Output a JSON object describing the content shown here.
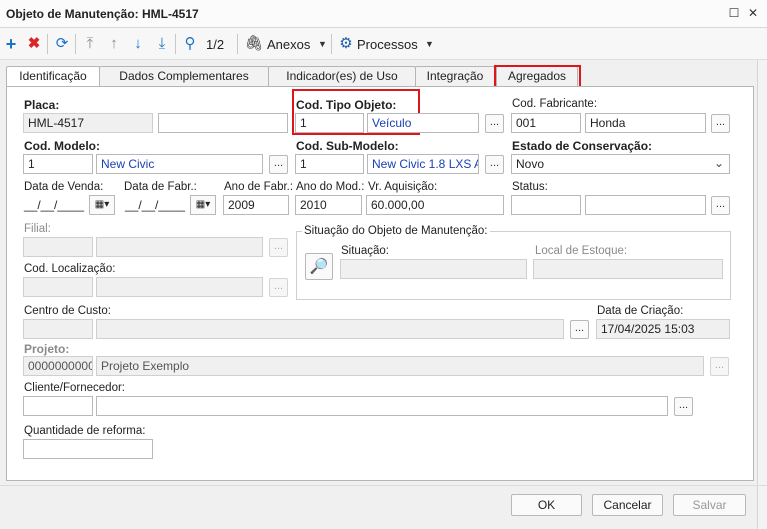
{
  "window": {
    "title": "Objeto de Manutenção: HML-4517"
  },
  "toolbar": {
    "page_indicator": "1/2",
    "attachments_label": "Anexos",
    "processes_label": "Processos"
  },
  "tabs": [
    {
      "label": "Identificação",
      "active": true
    },
    {
      "label": "Dados Complementares",
      "active": false
    },
    {
      "label": "Indicador(es) de Uso",
      "active": false
    },
    {
      "label": "Integração",
      "active": false
    },
    {
      "label": "Agregados",
      "active": false,
      "highlighted": true
    }
  ],
  "form": {
    "placa": {
      "label": "Placa:",
      "value": "HML-4517",
      "value2": ""
    },
    "cod_tipo_objeto": {
      "label": "Cod. Tipo Objeto:",
      "code": "1",
      "description": "Veículo",
      "extra": ""
    },
    "cod_fabricante": {
      "label": "Cod. Fabricante:",
      "code": "001",
      "description": "Honda"
    },
    "cod_modelo": {
      "label": "Cod. Modelo:",
      "code": "1",
      "description": "New Civic"
    },
    "cod_sub_modelo": {
      "label": "Cod. Sub-Modelo:",
      "code": "1",
      "description": "New Civic 1.8 LXS  AT"
    },
    "estado_conservacao": {
      "label": "Estado de Conservação:",
      "value": "Novo"
    },
    "data_venda": {
      "label": "Data de Venda:",
      "value": "__/__/____"
    },
    "data_fabr": {
      "label": "Data de Fabr.:",
      "value": "__/__/____"
    },
    "ano_fabr": {
      "label": "Ano de Fabr.:",
      "value": "2009"
    },
    "ano_mod": {
      "label": "Ano do Mod.:",
      "value": "2010"
    },
    "vr_aquisicao": {
      "label": "Vr. Aquisição:",
      "value": "60.000,00"
    },
    "status": {
      "label": "Status:",
      "code": "",
      "description": ""
    },
    "filial": {
      "label": "Filial:"
    },
    "cod_localizacao": {
      "label": "Cod. Localização:"
    },
    "situacao_group": {
      "title": "Situação do Objeto de Manutenção:",
      "situacao_label": "Situação:",
      "local_estoque_label": "Local de Estoque:"
    },
    "centro_custo": {
      "label": "Centro de Custo:"
    },
    "data_criacao": {
      "label": "Data de Criação:",
      "value": "17/04/2025 15:03"
    },
    "projeto": {
      "label": "Projeto:",
      "code": "0000000000",
      "description": "Projeto Exemplo"
    },
    "cliente_fornecedor": {
      "label": "Cliente/Fornecedor:"
    },
    "quantidade_reforma": {
      "label": "Quantidade de reforma:",
      "value": ""
    },
    "ellipsis": "..."
  },
  "buttons": {
    "ok": "OK",
    "cancel": "Cancelar",
    "save": "Salvar"
  },
  "colors": {
    "highlight": "#e0151b",
    "link_blue": "#1a3fb3",
    "add_blue": "#1a73c8",
    "delete_red": "#d9262b"
  }
}
